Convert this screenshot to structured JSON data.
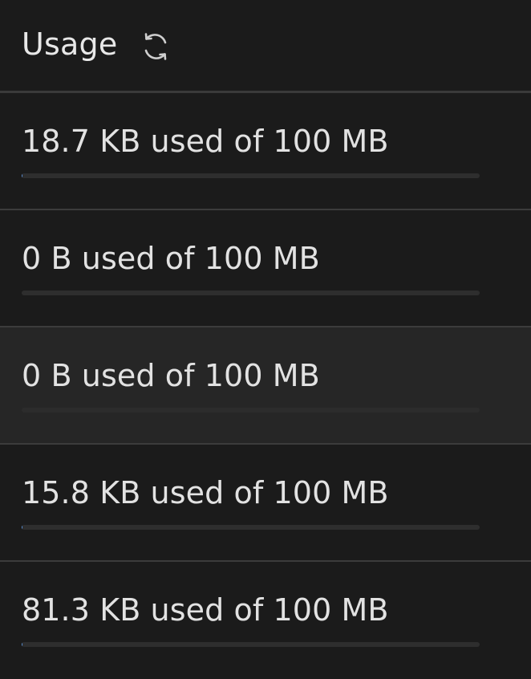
{
  "header": {
    "title": "Usage",
    "refresh_icon": "refresh-icon"
  },
  "rows": [
    {
      "label": "18.7 KB used of 100 MB",
      "fraction": 0.000187
    },
    {
      "label": "0 B used of 100 MB",
      "fraction": 0
    },
    {
      "label": "0 B used of 100 MB",
      "fraction": 0,
      "selected": true
    },
    {
      "label": "15.8 KB used of 100 MB",
      "fraction": 0.000158
    },
    {
      "label": "81.3 KB used of 100 MB",
      "fraction": 0.000813
    }
  ],
  "colors": {
    "background": "#1b1b1b",
    "bar_track": "#2e2e2e",
    "bar_fill": "#5a8fd6",
    "divider": "#3c3c3c"
  }
}
